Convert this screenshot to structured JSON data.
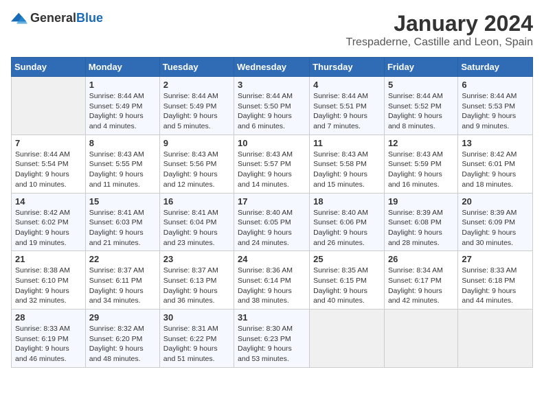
{
  "logo": {
    "text_general": "General",
    "text_blue": "Blue"
  },
  "header": {
    "month_year": "January 2024",
    "location": "Trespaderne, Castille and Leon, Spain"
  },
  "days_of_week": [
    "Sunday",
    "Monday",
    "Tuesday",
    "Wednesday",
    "Thursday",
    "Friday",
    "Saturday"
  ],
  "weeks": [
    [
      {
        "day": "",
        "empty": true
      },
      {
        "day": "1",
        "sunrise": "Sunrise: 8:44 AM",
        "sunset": "Sunset: 5:49 PM",
        "daylight": "Daylight: 9 hours and 4 minutes."
      },
      {
        "day": "2",
        "sunrise": "Sunrise: 8:44 AM",
        "sunset": "Sunset: 5:49 PM",
        "daylight": "Daylight: 9 hours and 5 minutes."
      },
      {
        "day": "3",
        "sunrise": "Sunrise: 8:44 AM",
        "sunset": "Sunset: 5:50 PM",
        "daylight": "Daylight: 9 hours and 6 minutes."
      },
      {
        "day": "4",
        "sunrise": "Sunrise: 8:44 AM",
        "sunset": "Sunset: 5:51 PM",
        "daylight": "Daylight: 9 hours and 7 minutes."
      },
      {
        "day": "5",
        "sunrise": "Sunrise: 8:44 AM",
        "sunset": "Sunset: 5:52 PM",
        "daylight": "Daylight: 9 hours and 8 minutes."
      },
      {
        "day": "6",
        "sunrise": "Sunrise: 8:44 AM",
        "sunset": "Sunset: 5:53 PM",
        "daylight": "Daylight: 9 hours and 9 minutes."
      }
    ],
    [
      {
        "day": "7",
        "sunrise": "Sunrise: 8:44 AM",
        "sunset": "Sunset: 5:54 PM",
        "daylight": "Daylight: 9 hours and 10 minutes."
      },
      {
        "day": "8",
        "sunrise": "Sunrise: 8:43 AM",
        "sunset": "Sunset: 5:55 PM",
        "daylight": "Daylight: 9 hours and 11 minutes."
      },
      {
        "day": "9",
        "sunrise": "Sunrise: 8:43 AM",
        "sunset": "Sunset: 5:56 PM",
        "daylight": "Daylight: 9 hours and 12 minutes."
      },
      {
        "day": "10",
        "sunrise": "Sunrise: 8:43 AM",
        "sunset": "Sunset: 5:57 PM",
        "daylight": "Daylight: 9 hours and 14 minutes."
      },
      {
        "day": "11",
        "sunrise": "Sunrise: 8:43 AM",
        "sunset": "Sunset: 5:58 PM",
        "daylight": "Daylight: 9 hours and 15 minutes."
      },
      {
        "day": "12",
        "sunrise": "Sunrise: 8:43 AM",
        "sunset": "Sunset: 5:59 PM",
        "daylight": "Daylight: 9 hours and 16 minutes."
      },
      {
        "day": "13",
        "sunrise": "Sunrise: 8:42 AM",
        "sunset": "Sunset: 6:01 PM",
        "daylight": "Daylight: 9 hours and 18 minutes."
      }
    ],
    [
      {
        "day": "14",
        "sunrise": "Sunrise: 8:42 AM",
        "sunset": "Sunset: 6:02 PM",
        "daylight": "Daylight: 9 hours and 19 minutes."
      },
      {
        "day": "15",
        "sunrise": "Sunrise: 8:41 AM",
        "sunset": "Sunset: 6:03 PM",
        "daylight": "Daylight: 9 hours and 21 minutes."
      },
      {
        "day": "16",
        "sunrise": "Sunrise: 8:41 AM",
        "sunset": "Sunset: 6:04 PM",
        "daylight": "Daylight: 9 hours and 23 minutes."
      },
      {
        "day": "17",
        "sunrise": "Sunrise: 8:40 AM",
        "sunset": "Sunset: 6:05 PM",
        "daylight": "Daylight: 9 hours and 24 minutes."
      },
      {
        "day": "18",
        "sunrise": "Sunrise: 8:40 AM",
        "sunset": "Sunset: 6:06 PM",
        "daylight": "Daylight: 9 hours and 26 minutes."
      },
      {
        "day": "19",
        "sunrise": "Sunrise: 8:39 AM",
        "sunset": "Sunset: 6:08 PM",
        "daylight": "Daylight: 9 hours and 28 minutes."
      },
      {
        "day": "20",
        "sunrise": "Sunrise: 8:39 AM",
        "sunset": "Sunset: 6:09 PM",
        "daylight": "Daylight: 9 hours and 30 minutes."
      }
    ],
    [
      {
        "day": "21",
        "sunrise": "Sunrise: 8:38 AM",
        "sunset": "Sunset: 6:10 PM",
        "daylight": "Daylight: 9 hours and 32 minutes."
      },
      {
        "day": "22",
        "sunrise": "Sunrise: 8:37 AM",
        "sunset": "Sunset: 6:11 PM",
        "daylight": "Daylight: 9 hours and 34 minutes."
      },
      {
        "day": "23",
        "sunrise": "Sunrise: 8:37 AM",
        "sunset": "Sunset: 6:13 PM",
        "daylight": "Daylight: 9 hours and 36 minutes."
      },
      {
        "day": "24",
        "sunrise": "Sunrise: 8:36 AM",
        "sunset": "Sunset: 6:14 PM",
        "daylight": "Daylight: 9 hours and 38 minutes."
      },
      {
        "day": "25",
        "sunrise": "Sunrise: 8:35 AM",
        "sunset": "Sunset: 6:15 PM",
        "daylight": "Daylight: 9 hours and 40 minutes."
      },
      {
        "day": "26",
        "sunrise": "Sunrise: 8:34 AM",
        "sunset": "Sunset: 6:17 PM",
        "daylight": "Daylight: 9 hours and 42 minutes."
      },
      {
        "day": "27",
        "sunrise": "Sunrise: 8:33 AM",
        "sunset": "Sunset: 6:18 PM",
        "daylight": "Daylight: 9 hours and 44 minutes."
      }
    ],
    [
      {
        "day": "28",
        "sunrise": "Sunrise: 8:33 AM",
        "sunset": "Sunset: 6:19 PM",
        "daylight": "Daylight: 9 hours and 46 minutes."
      },
      {
        "day": "29",
        "sunrise": "Sunrise: 8:32 AM",
        "sunset": "Sunset: 6:20 PM",
        "daylight": "Daylight: 9 hours and 48 minutes."
      },
      {
        "day": "30",
        "sunrise": "Sunrise: 8:31 AM",
        "sunset": "Sunset: 6:22 PM",
        "daylight": "Daylight: 9 hours and 51 minutes."
      },
      {
        "day": "31",
        "sunrise": "Sunrise: 8:30 AM",
        "sunset": "Sunset: 6:23 PM",
        "daylight": "Daylight: 9 hours and 53 minutes."
      },
      {
        "day": "",
        "empty": true
      },
      {
        "day": "",
        "empty": true
      },
      {
        "day": "",
        "empty": true
      }
    ]
  ]
}
